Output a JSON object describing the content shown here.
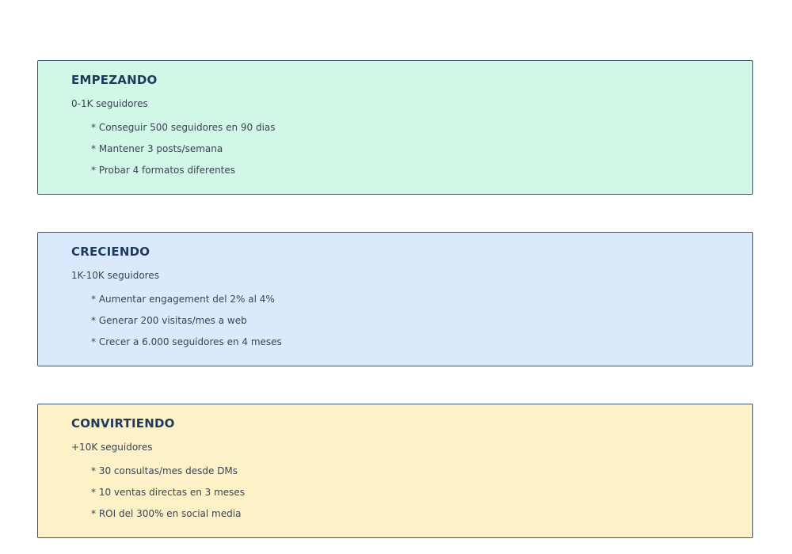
{
  "stages": [
    {
      "title": "EMPEZANDO",
      "subtitle": "0-1K seguidores",
      "color": "#d1f7e6",
      "goals": [
        "* Conseguir 500 seguidores en 90 dias",
        "* Mantener 3 posts/semana",
        "* Probar 4 formatos diferentes"
      ]
    },
    {
      "title": "CRECIENDO",
      "subtitle": "1K-10K seguidores",
      "color": "#dbe9fc",
      "goals": [
        "* Aumentar engagement del 2% al 4%",
        "* Generar 200 visitas/mes a web",
        "* Crecer a 6.000 seguidores en 4 meses"
      ]
    },
    {
      "title": "CONVIRTIENDO",
      "subtitle": "+10K seguidores",
      "color": "#fdf1c8",
      "goals": [
        "* 30 consultas/mes desde DMs",
        "* 10 ventas directas en 3 meses",
        "* ROI del 300% en social media"
      ]
    }
  ]
}
